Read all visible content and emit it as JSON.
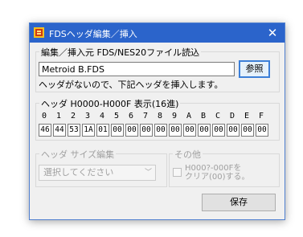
{
  "window": {
    "title": "FDSヘッダ編集／挿入",
    "close_glyph": "✕"
  },
  "source": {
    "group_label": "編集／挿入元 FDS/NES20ファイル読込",
    "filename": "Metroid B.FDS",
    "browse_label": "参照",
    "status": "ヘッダがないので、下記ヘッダを挿入します。"
  },
  "header": {
    "group_label": "ヘッダ H0000-H000F 表示(16進)",
    "columns": [
      "0",
      "1",
      "2",
      "3",
      "4",
      "5",
      "6",
      "7",
      "8",
      "9",
      "A",
      "B",
      "C",
      "D",
      "E",
      "F"
    ],
    "bytes": [
      "46",
      "44",
      "53",
      "1A",
      "01",
      "00",
      "00",
      "00",
      "00",
      "00",
      "00",
      "00",
      "00",
      "00",
      "00",
      "00"
    ]
  },
  "size_edit": {
    "group_label": "ヘッダ サイズ編集",
    "select_value": "選択してください"
  },
  "other": {
    "group_label": "その他",
    "checkbox_line1": "H000?-000Fを",
    "checkbox_line2": "クリア(00)する。"
  },
  "footer": {
    "save_label": "保存"
  },
  "colors": {
    "titlebar": "#2b64cb",
    "focus_border": "#3c7fd8"
  }
}
